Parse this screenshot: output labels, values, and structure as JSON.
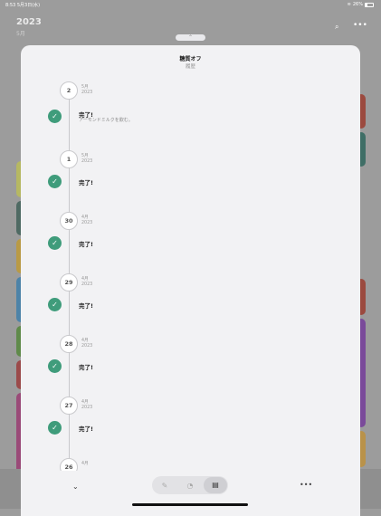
{
  "status_bar": {
    "time": "8:53",
    "date": "5月3日(水)",
    "battery": "26%",
    "battery_level": 0.26
  },
  "background": {
    "year": "2023",
    "month": "5月"
  },
  "sheet": {
    "title": "糖質オフ",
    "subtitle": "履歴",
    "entries": [
      {
        "day": "2",
        "month": "5月",
        "year": "2023",
        "status": "完了!",
        "note": "アーモンドミルクを飲む。"
      },
      {
        "day": "1",
        "month": "5月",
        "year": "2023",
        "status": "完了!",
        "note": ""
      },
      {
        "day": "30",
        "month": "4月",
        "year": "2023",
        "status": "完了!",
        "note": ""
      },
      {
        "day": "29",
        "month": "4月",
        "year": "2023",
        "status": "完了!",
        "note": ""
      },
      {
        "day": "28",
        "month": "4月",
        "year": "2023",
        "status": "完了!",
        "note": ""
      },
      {
        "day": "27",
        "month": "4月",
        "year": "2023",
        "status": "完了!",
        "note": ""
      },
      {
        "day": "26",
        "month": "4月",
        "year": "",
        "status": "",
        "note": ""
      }
    ]
  },
  "toolbar": {
    "segments": [
      "edit-icon",
      "clock-icon",
      "history-icon"
    ],
    "selected_segment": "history-icon"
  },
  "colors": {
    "check": "#3f9c7b",
    "sheet_bg": "#f2f2f4",
    "dim_bg": "#9c9c9c"
  }
}
